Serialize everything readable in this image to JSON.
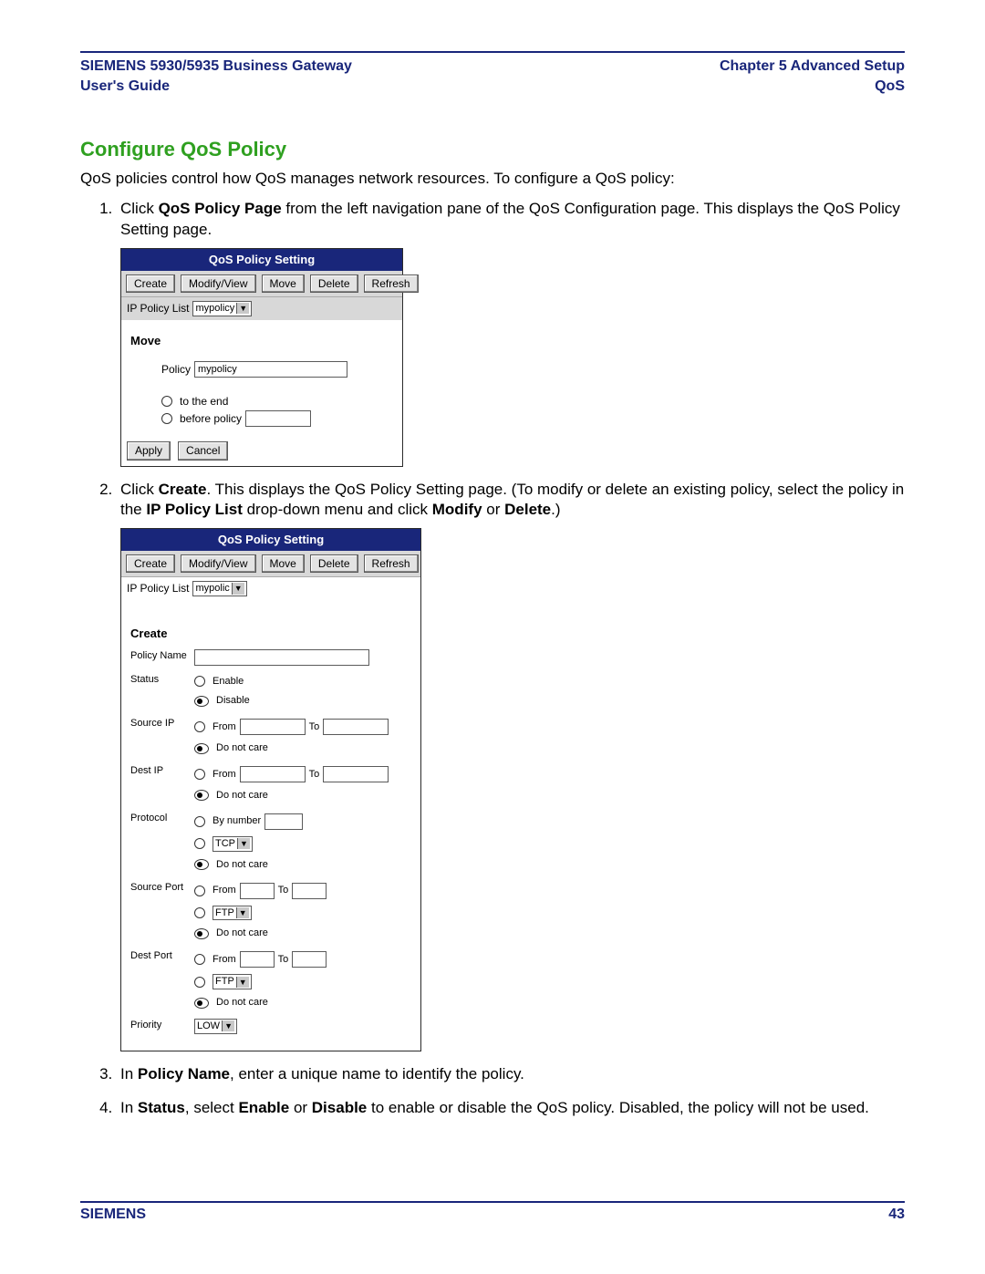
{
  "header": {
    "left_line1": "SIEMENS 5930/5935 Business Gateway",
    "left_line2": "User's Guide",
    "right_line1": "Chapter 5  Advanced Setup",
    "right_line2": "QoS"
  },
  "section_title": "Configure QoS Policy",
  "intro": "QoS policies control how QoS manages network resources. To configure a QoS policy:",
  "step1": {
    "pre": "Click ",
    "b1": "QoS Policy Page",
    "post": " from the left navigation pane of the QoS Configuration page. This displays the QoS Policy Setting page."
  },
  "shot1": {
    "title": "QoS Policy Setting",
    "buttons": {
      "create": "Create",
      "modify": "Modify/View",
      "move": "Move",
      "delete": "Delete",
      "refresh": "Refresh"
    },
    "ip_policy_list_label": "IP Policy List",
    "ip_policy_list_value": "mypolicy",
    "move_heading": "Move",
    "policy_label": "Policy",
    "policy_value": "mypolicy",
    "opt_to_end": "to the end",
    "opt_before": "before policy",
    "apply": "Apply",
    "cancel": "Cancel"
  },
  "step2": {
    "pre": "Click ",
    "b1": "Create",
    "mid1": ". This displays the QoS Policy Setting page. (To modify or delete an existing policy, select the policy in the ",
    "b2": "IP Policy List",
    "mid2": " drop-down menu and click ",
    "b3": "Modify",
    "mid3": " or ",
    "b4": "Delete",
    "post": ".)"
  },
  "shot2": {
    "title": "QoS Policy Setting",
    "buttons": {
      "create": "Create",
      "modify": "Modify/View",
      "move": "Move",
      "delete": "Delete",
      "refresh": "Refresh"
    },
    "ip_policy_list_label": "IP Policy List",
    "ip_policy_list_value": "mypolic",
    "create_heading": "Create",
    "fields": {
      "policy_name": "Policy Name",
      "status": "Status",
      "source_ip": "Source IP",
      "dest_ip": "Dest IP",
      "protocol": "Protocol",
      "source_port": "Source Port",
      "dest_port": "Dest Port",
      "priority": "Priority"
    },
    "opts": {
      "enable": "Enable",
      "disable": "Disable",
      "from": "From",
      "to": "To",
      "do_not_care": "Do not care",
      "by_number": "By number",
      "tcp": "TCP",
      "ftp": "FTP",
      "low": "LOW"
    }
  },
  "step3": {
    "pre": "In ",
    "b1": "Policy Name",
    "post": ", enter a unique name to identify the policy."
  },
  "step4": {
    "pre": "In ",
    "b1": "Status",
    "mid1": ", select ",
    "b2": "Enable",
    "mid2": " or ",
    "b3": "Disable",
    "post": " to enable or disable the QoS policy. Disabled, the policy will not be used."
  },
  "footer": {
    "brand": "SIEMENS",
    "page": "43"
  }
}
